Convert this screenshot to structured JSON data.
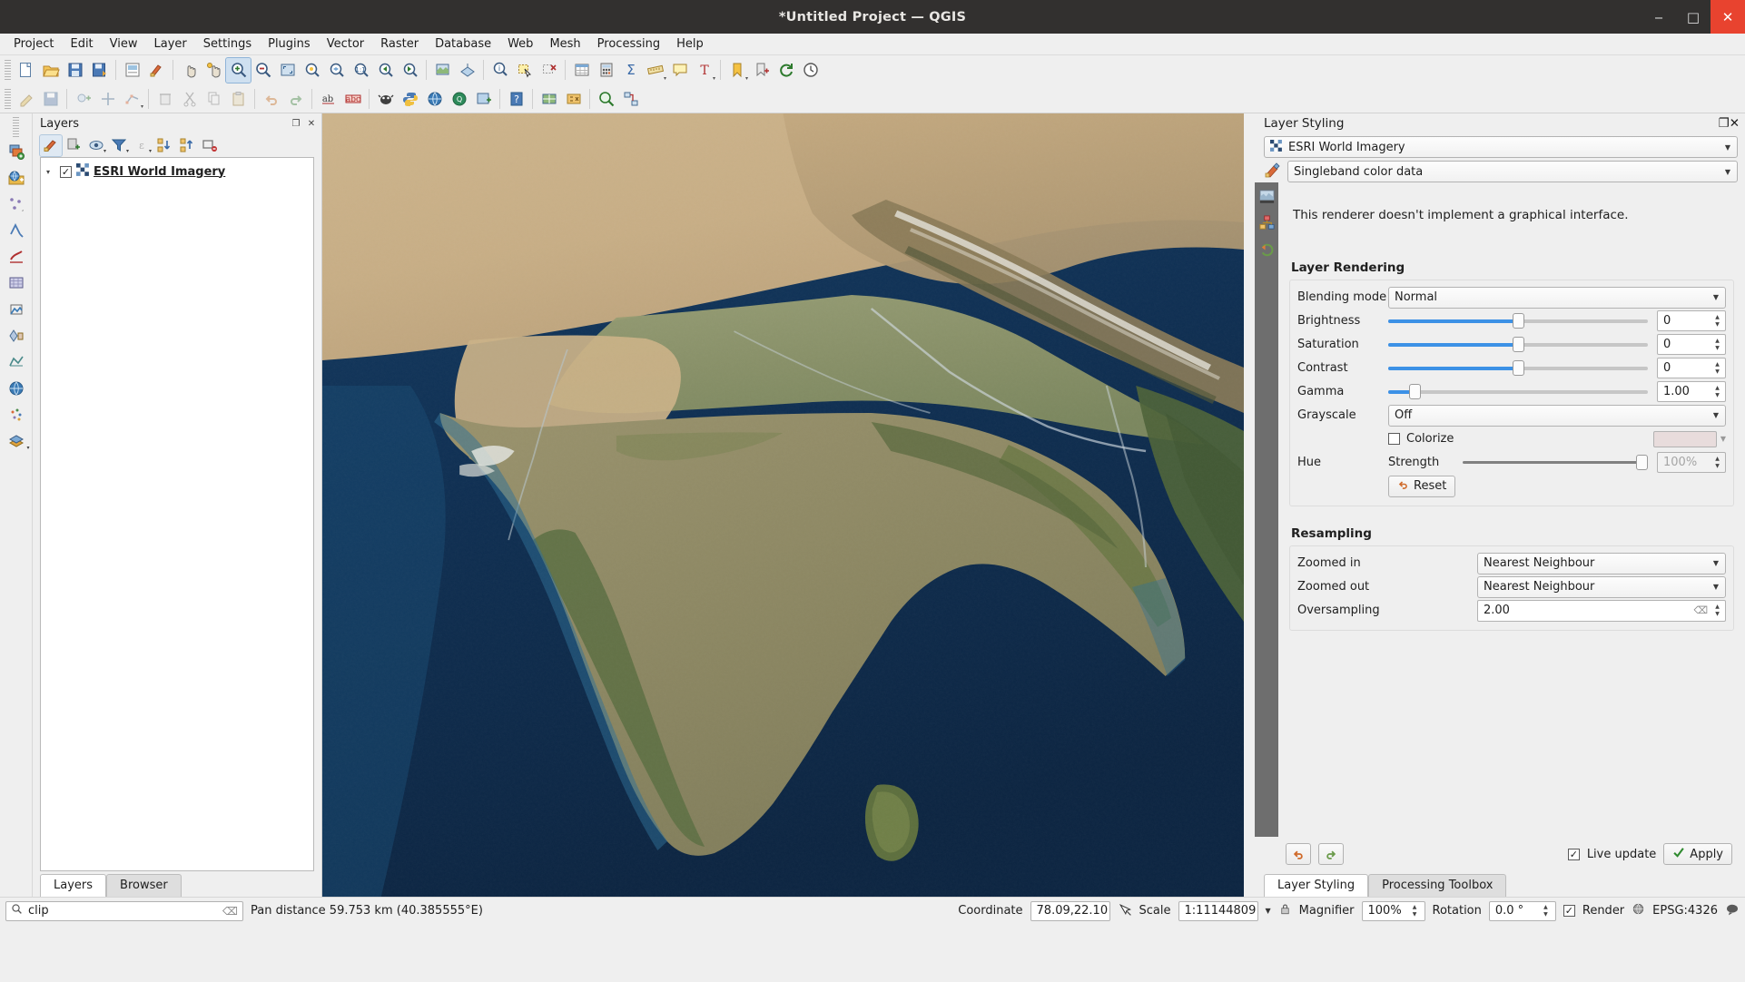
{
  "window": {
    "title": "*Untitled Project — QGIS",
    "minimize": "‒",
    "maximize": "□",
    "close": "✕"
  },
  "menubar": {
    "items": [
      {
        "label": "Project"
      },
      {
        "label": "Edit"
      },
      {
        "label": "View"
      },
      {
        "label": "Layer"
      },
      {
        "label": "Settings"
      },
      {
        "label": "Plugins"
      },
      {
        "label": "Vector"
      },
      {
        "label": "Raster"
      },
      {
        "label": "Database"
      },
      {
        "label": "Web"
      },
      {
        "label": "Mesh"
      },
      {
        "label": "Processing"
      },
      {
        "label": "Help"
      }
    ]
  },
  "layers_panel": {
    "title": "Layers",
    "undock_glyph": "❐",
    "close_glyph": "✕",
    "toolbar": [
      {
        "name": "open-layer-styling-panel",
        "active": true
      },
      {
        "name": "add-group"
      },
      {
        "name": "manage-map-themes"
      },
      {
        "name": "filter-legend-by-map-content"
      },
      {
        "name": "filter-legend-by-expression"
      },
      {
        "name": "expand-all"
      },
      {
        "name": "collapse-all"
      },
      {
        "name": "remove-layer-group"
      }
    ],
    "tree": [
      {
        "name": "ESRI World Imagery",
        "checked": true,
        "check_glyph": "✓",
        "expand_glyph": "▾"
      }
    ],
    "tabs": [
      {
        "label": "Layers",
        "selected": true
      },
      {
        "label": "Browser",
        "selected": false
      }
    ]
  },
  "layer_styling": {
    "title": "Layer Styling",
    "undock_glyph": "❐",
    "close_glyph": "✕",
    "layer_selector": "ESRI World Imagery",
    "renderer": "Singleband color data",
    "renderer_note": "This renderer doesn't implement a graphical interface.",
    "rendering": {
      "title": "Layer Rendering",
      "blending_mode_label": "Blending mode",
      "blending_mode": "Normal",
      "sliders": [
        {
          "label": "Brightness",
          "value": "0",
          "pct": 50
        },
        {
          "label": "Saturation",
          "value": "0",
          "pct": 50
        },
        {
          "label": "Contrast",
          "value": "0",
          "pct": 50
        },
        {
          "label": "Gamma",
          "value": "1.00",
          "pct": 10
        }
      ],
      "grayscale_label": "Grayscale",
      "grayscale": "Off",
      "hue_label": "Hue",
      "colorize_label": "Colorize",
      "colorize_checked": false,
      "colorize_color": "#e8dcdc",
      "strength_label": "Strength",
      "strength_value": "100%",
      "strength_pct": 100,
      "reset_label": "Reset"
    },
    "resampling": {
      "title": "Resampling",
      "rows": [
        {
          "label": "Zoomed in",
          "value": "Nearest Neighbour",
          "type": "combo"
        },
        {
          "label": "Zoomed out",
          "value": "Nearest Neighbour",
          "type": "combo"
        },
        {
          "label": "Oversampling",
          "value": "2.00",
          "type": "spin"
        }
      ]
    },
    "footer": {
      "live_update_label": "Live update",
      "live_update_checked": true,
      "apply_label": "Apply"
    },
    "tabs": [
      {
        "label": "Layer Styling",
        "selected": true
      },
      {
        "label": "Processing Toolbox",
        "selected": false
      }
    ]
  },
  "statusbar": {
    "locator_placeholder": "Search",
    "locator_value": "clip",
    "clear_glyph": "⌫",
    "message": "Pan distance 59.753 km (40.385555°E)",
    "coordinate_label": "Coordinate",
    "coordinate_value": "78.09,22.10",
    "scale_label": "Scale",
    "scale_value": "1:11144809",
    "magnifier_label": "Magnifier",
    "magnifier_value": "100%",
    "rotation_label": "Rotation",
    "rotation_value": "0.0 °",
    "render_label": "Render",
    "render_checked": true,
    "crs_label": "EPSG:4326"
  },
  "toolbar_rows": {
    "row1": [
      "new-project",
      "open-project",
      "save-project",
      "save-project-as",
      "new-print-layout",
      "style-manager",
      "pan-map",
      "pan-to-selection",
      "zoom-in",
      "zoom-out",
      "zoom-full",
      "zoom-selection",
      "zoom-layer",
      "zoom-native",
      "zoom-last",
      "zoom-next",
      "refresh",
      "new-shapefile-layer",
      "new-geopackage-layer",
      "new-spatialite-layer",
      "new-memory-layer",
      "new-mesh-layer",
      "temporal-controller",
      "refresh-2",
      "identify-features",
      "select-features",
      "deselect-features",
      "open-attribute-table",
      "field-calculator",
      "measure-line",
      "show-map-tips",
      "text-annotation",
      "new-map-view",
      "show-statistics",
      "show-bookmarks",
      "new-3d-map-view",
      "show-spatial-bookmarks"
    ],
    "row2": [
      "toggle-editing",
      "save-layer-edits",
      "add-feature",
      "move-feature",
      "node-tool",
      "delete-selected",
      "cut-features",
      "copy-features",
      "paste-features",
      "undo",
      "redo",
      "modify-attributes",
      "label",
      "change-label",
      "diagram",
      "run-feature-action",
      "python-console",
      "metasearch",
      "show-help",
      "plugin-manager",
      "georeferencer",
      "data-source-manager",
      "qgis-server",
      "search-query",
      "processing-model"
    ]
  }
}
